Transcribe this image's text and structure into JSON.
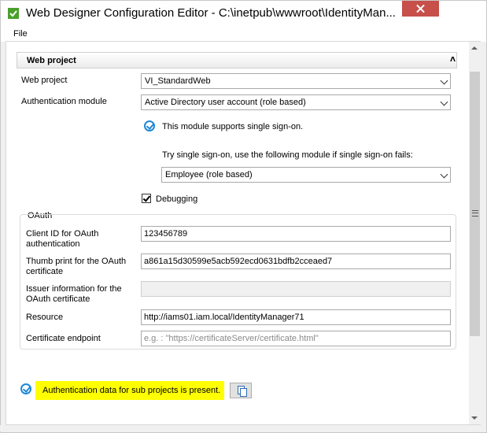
{
  "window": {
    "title": "Web Designer Configuration Editor - C:\\inetpub\\wwwroot\\IdentityMan..."
  },
  "menu": {
    "file": "File"
  },
  "section": {
    "title": "Web project",
    "collapse_glyph": "˄"
  },
  "form": {
    "web_project_label": "Web project",
    "web_project_value": "VI_StandardWeb",
    "auth_module_label": "Authentication module",
    "auth_module_value": "Active Directory user account (role based)",
    "sso_supported_text": "This module supports single sign-on.",
    "sso_fallback_label": "Try single sign-on, use the following module if single sign-on fails:",
    "sso_fallback_value": "Employee (role based)",
    "debugging_label": "Debugging",
    "debugging_checked": true
  },
  "oauth": {
    "group_label": "OAuth",
    "client_id_label": "Client ID for OAuth authentication",
    "client_id_value": "123456789",
    "thumbprint_label": "Thumb print for the OAuth certificate",
    "thumbprint_value": "a861a15d30599e5acb592ecd0631bdfb2cceaed7",
    "issuer_label": "Issuer information for the OAuth certificate",
    "issuer_value": "",
    "resource_label": "Resource",
    "resource_value": "http://iams01.iam.local/IdentityManager71",
    "cert_endpoint_label": "Certificate endpoint",
    "cert_endpoint_placeholder": "e.g. : \"https://certificateServer/certificate.html\""
  },
  "footer": {
    "subprojects_text": "Authentication data for sub projects is present."
  },
  "colors": {
    "accent": "#1e88d6",
    "highlight": "#ffff00",
    "close": "#c7504a"
  },
  "icons": {
    "app": "app-icon",
    "sso": "check-circle-icon",
    "copy": "copy-icon"
  }
}
